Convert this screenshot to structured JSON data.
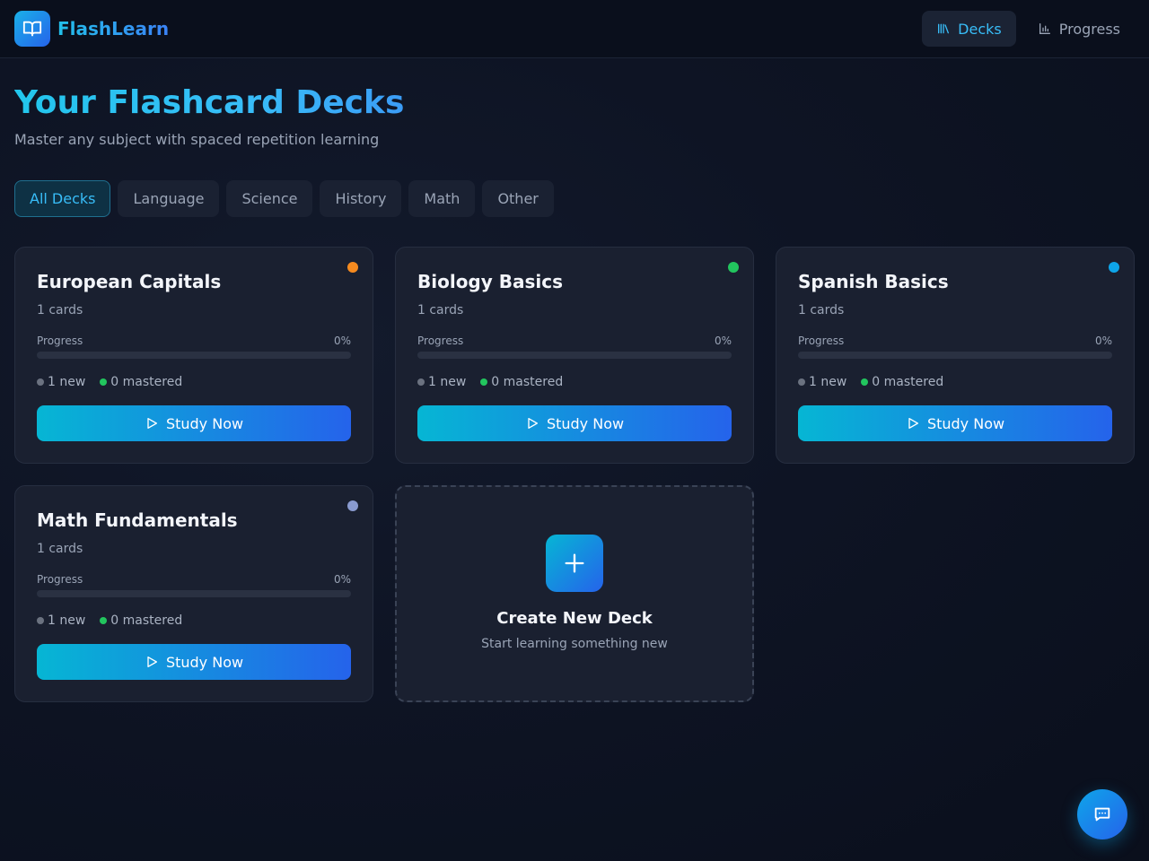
{
  "app": {
    "name": "FlashLearn",
    "logo_icon": "book-open-icon"
  },
  "nav": {
    "items": [
      {
        "label": "Decks",
        "icon": "library-icon",
        "active": true
      },
      {
        "label": "Progress",
        "icon": "bar-chart-icon",
        "active": false
      }
    ]
  },
  "page": {
    "title": "Your Flashcard Decks",
    "subtitle": "Master any subject with spaced repetition learning"
  },
  "filters": [
    "All Decks",
    "Language",
    "Science",
    "History",
    "Math",
    "Other"
  ],
  "active_filter": "All Decks",
  "deck_labels": {
    "progress": "Progress",
    "study": "Study Now"
  },
  "decks": [
    {
      "title": "European Capitals",
      "count": "1 cards",
      "progress_pct": "0%",
      "progress": 0,
      "new": "1 new",
      "mastered": "0 mastered",
      "dot_color": "#f58a1f"
    },
    {
      "title": "Biology Basics",
      "count": "1 cards",
      "progress_pct": "0%",
      "progress": 0,
      "new": "1 new",
      "mastered": "0 mastered",
      "dot_color": "#22c55e"
    },
    {
      "title": "Spanish Basics",
      "count": "1 cards",
      "progress_pct": "0%",
      "progress": 0,
      "new": "1 new",
      "mastered": "0 mastered",
      "dot_color": "#0ea5e9"
    },
    {
      "title": "Math Fundamentals",
      "count": "1 cards",
      "progress_pct": "0%",
      "progress": 0,
      "new": "1 new",
      "mastered": "0 mastered",
      "dot_color": "#8a9bd0"
    }
  ],
  "create": {
    "title": "Create New Deck",
    "subtitle": "Start learning something new",
    "icon": "plus-icon"
  },
  "chat": {
    "icon": "chat-bubble-icon"
  },
  "colors": {
    "accent": "#38bdf8",
    "new_dot": "#6b7280",
    "mastered_dot": "#22c55e",
    "background": "#0e1424"
  }
}
